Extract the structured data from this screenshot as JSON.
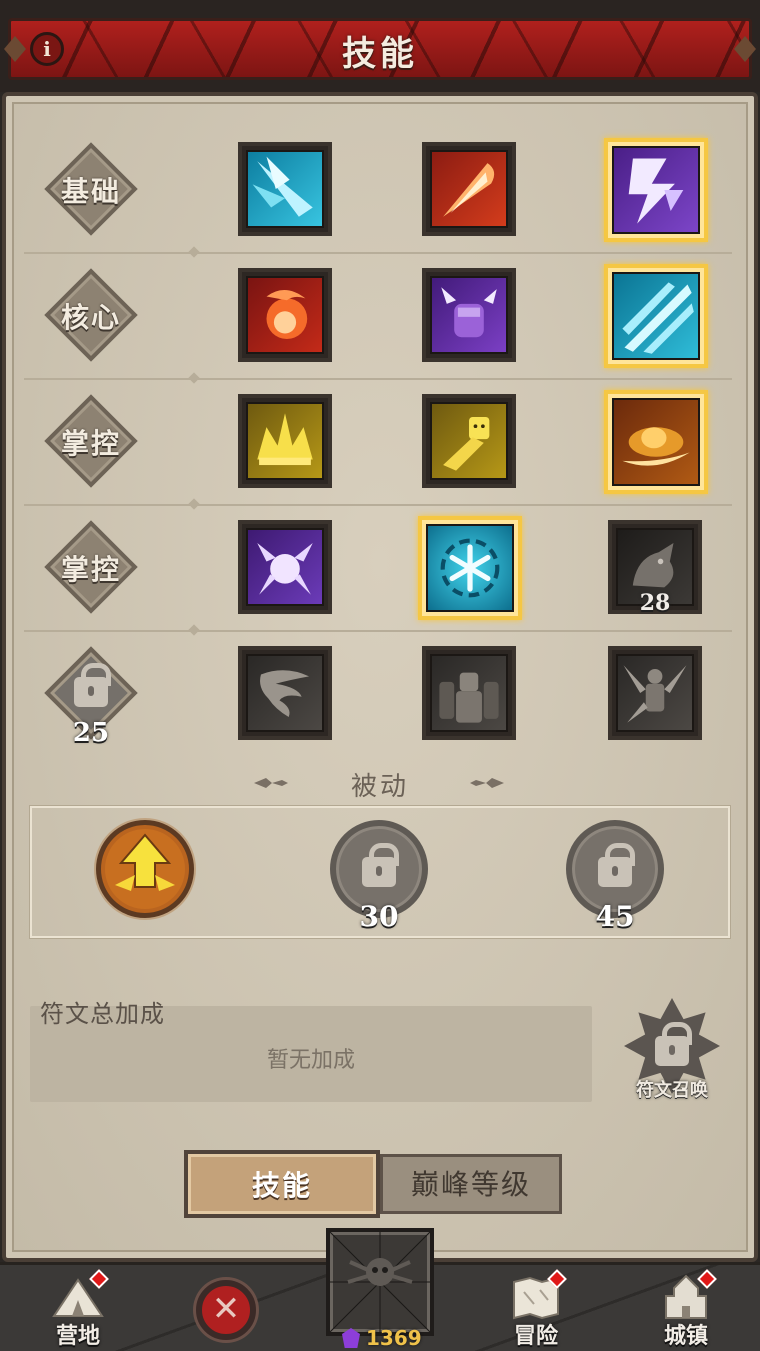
{
  "header": {
    "title": "技能",
    "info_icon": "i"
  },
  "skill_rows": [
    {
      "label": "基础",
      "locked": false,
      "lock_level": ""
    },
    {
      "label": "核心",
      "locked": false,
      "lock_level": ""
    },
    {
      "label": "掌控",
      "locked": false,
      "lock_level": ""
    },
    {
      "label": "掌控",
      "locked": false,
      "lock_level": ""
    },
    {
      "label": "",
      "locked": true,
      "lock_level": "25"
    }
  ],
  "skills": {
    "r1": [
      {
        "icon": "ice-shard-icon",
        "selected": false
      },
      {
        "icon": "fire-bolt-icon",
        "selected": false
      },
      {
        "icon": "lightning-icon",
        "selected": true
      }
    ],
    "r2": [
      {
        "icon": "fireball-icon",
        "selected": false
      },
      {
        "icon": "shock-fist-icon",
        "selected": false
      },
      {
        "icon": "frost-shards-icon",
        "selected": true
      }
    ],
    "r3": [
      {
        "icon": "golden-crown-icon",
        "selected": false
      },
      {
        "icon": "golden-spirit-icon",
        "selected": false
      },
      {
        "icon": "fire-vortex-icon",
        "selected": true
      }
    ],
    "r4": [
      {
        "icon": "lightning-orb-icon",
        "selected": false
      },
      {
        "icon": "snowflake-icon",
        "selected": true
      },
      {
        "icon": "locked-dragon-icon",
        "selected": false,
        "lock_level": "28"
      }
    ],
    "r5": [
      {
        "icon": "tornado-icon",
        "selected": false
      },
      {
        "icon": "summon-shades-icon",
        "selected": false
      },
      {
        "icon": "shattered-figure-icon",
        "selected": false
      }
    ]
  },
  "passive": {
    "title": "被动",
    "slots": [
      {
        "state": "active",
        "icon": "arrow-up-icon",
        "level": ""
      },
      {
        "state": "locked",
        "icon": "lock-icon",
        "level": "30"
      },
      {
        "state": "locked",
        "icon": "lock-icon",
        "level": "45"
      }
    ]
  },
  "rune": {
    "title": "符文总加成",
    "empty_text": "暂无加成",
    "summon_label": "符文召唤"
  },
  "tabs": {
    "skills": "技能",
    "paragon": "巅峰等级",
    "active": "skills"
  },
  "nav": {
    "camp": "营地",
    "adventure": "冒险",
    "town": "城镇",
    "currency_value": "1369"
  },
  "colors": {
    "accent_red": "#b0201d",
    "selected_gold": "#f5c743",
    "panel": "#cfc6b4",
    "currency": "#f0c24a"
  }
}
